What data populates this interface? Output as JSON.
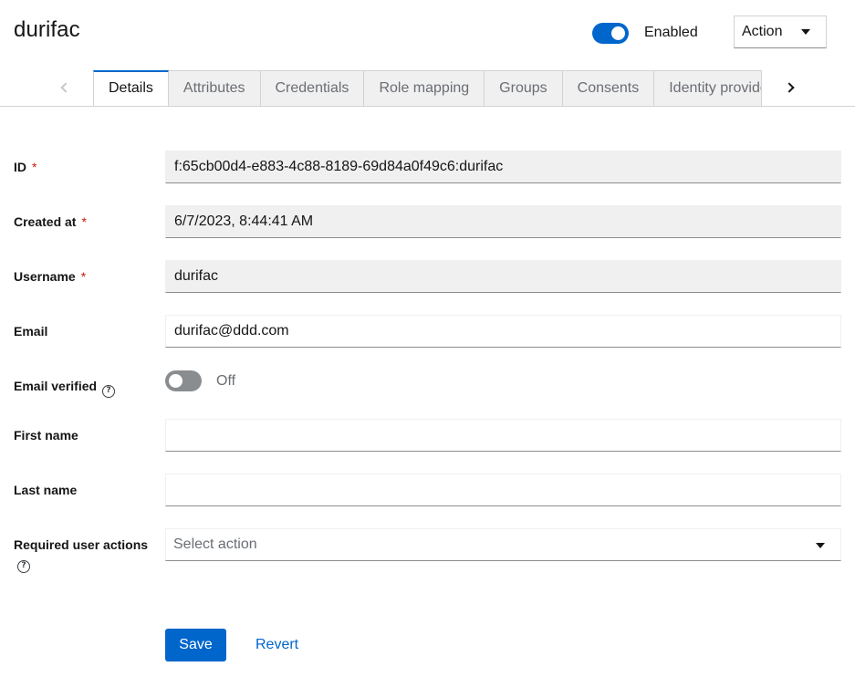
{
  "header": {
    "title": "durifac",
    "enabled_label": "Enabled",
    "enabled_on": true,
    "action_label": "Action"
  },
  "tabs": [
    {
      "label": "Details",
      "active": true
    },
    {
      "label": "Attributes",
      "active": false
    },
    {
      "label": "Credentials",
      "active": false
    },
    {
      "label": "Role mapping",
      "active": false
    },
    {
      "label": "Groups",
      "active": false
    },
    {
      "label": "Consents",
      "active": false
    },
    {
      "label": "Identity provider links",
      "active": false
    }
  ],
  "form": {
    "id_label": "ID",
    "id_value": "f:65cb00d4-e883-4c88-8189-69d84a0f49c6:durifac",
    "created_label": "Created at",
    "created_value": "6/7/2023, 8:44:41 AM",
    "username_label": "Username",
    "username_value": "durifac",
    "email_label": "Email",
    "email_value": "durifac@ddd.com",
    "email_verified_label": "Email verified",
    "email_verified_state": "Off",
    "first_name_label": "First name",
    "first_name_value": "",
    "last_name_label": "Last name",
    "last_name_value": "",
    "required_actions_label": "Required user actions",
    "required_actions_placeholder": "Select action",
    "required_marker": "*"
  },
  "footer": {
    "save_label": "Save",
    "revert_label": "Revert"
  },
  "colors": {
    "primary": "#0066cc",
    "required": "#c9190b",
    "readonly_bg": "#f0f0f0"
  }
}
